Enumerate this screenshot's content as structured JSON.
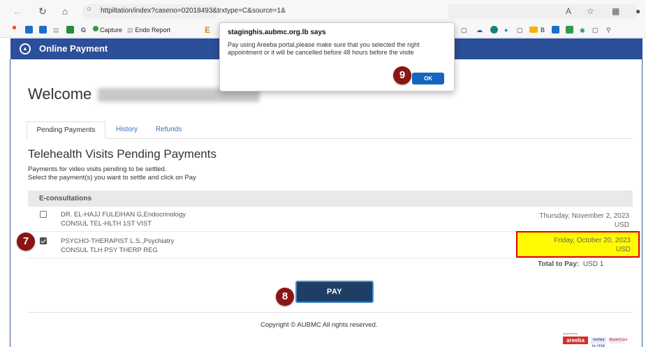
{
  "browser": {
    "url": "httpiltation/index?caseno=02018493&trxtype=C&source=1&",
    "read_aloud_label": "A",
    "favorites": {
      "capture_label": "Capture",
      "endo_report_label": "Endo Report",
      "g_label": "G",
      "e_label": "E",
      "b_label": "B"
    }
  },
  "header": {
    "title": "Online Payment"
  },
  "welcome": {
    "text": "Welcome"
  },
  "tabs": [
    {
      "label": "Pending Payments"
    },
    {
      "label": "History"
    },
    {
      "label": "Refunds"
    }
  ],
  "section": {
    "title": "Telehealth Visits Pending Payments",
    "desc_1": "Payments for video visits pending to be settled.",
    "desc_2": "Select the payment(s) you want to settle and click on Pay"
  },
  "group": {
    "label": "E-consultations"
  },
  "rows": [
    {
      "doctor": "DR. EL-HAJJ FULEIHAN G,Endocrinology",
      "type": "CONSUL TEL-HLTH 1ST VIST",
      "date": "Thursday, November 2, 2023",
      "currency": "USD",
      "checked": false
    },
    {
      "doctor": "PSYCHO-THERAPIST L.S.,Psychiatry",
      "type": "CONSUL TLH PSY THERP REG",
      "date": "Friday, October 20, 2023",
      "currency": "USD",
      "checked": true
    }
  ],
  "total": {
    "label": "Total to Pay:",
    "value": "USD 1"
  },
  "pay_button": {
    "label": "PAY"
  },
  "footer": {
    "copyright": "Copyright © AUBMC All rights reserved.",
    "powered_by": "powered by",
    "areeba": "areeba",
    "visa": "Verified by VISA",
    "mastercard": "MasterCard"
  },
  "markers": {
    "m7": "7",
    "m8": "8",
    "m9": "9"
  },
  "dialog": {
    "title": "staginghis.aubmc.org.lb says",
    "message": "Pay using Areeba portal,please make sure that you selected the right appointment or it will be cancelled before 48 hours before the visite",
    "ok_label": "OK"
  },
  "colors": {
    "header_blue": "#2b4f99",
    "pay_button": "#1f3e66",
    "highlight_yellow": "#fffa00",
    "highlight_border": "#e00000",
    "marker": "#8b1414",
    "ok_button": "#1565c0"
  }
}
